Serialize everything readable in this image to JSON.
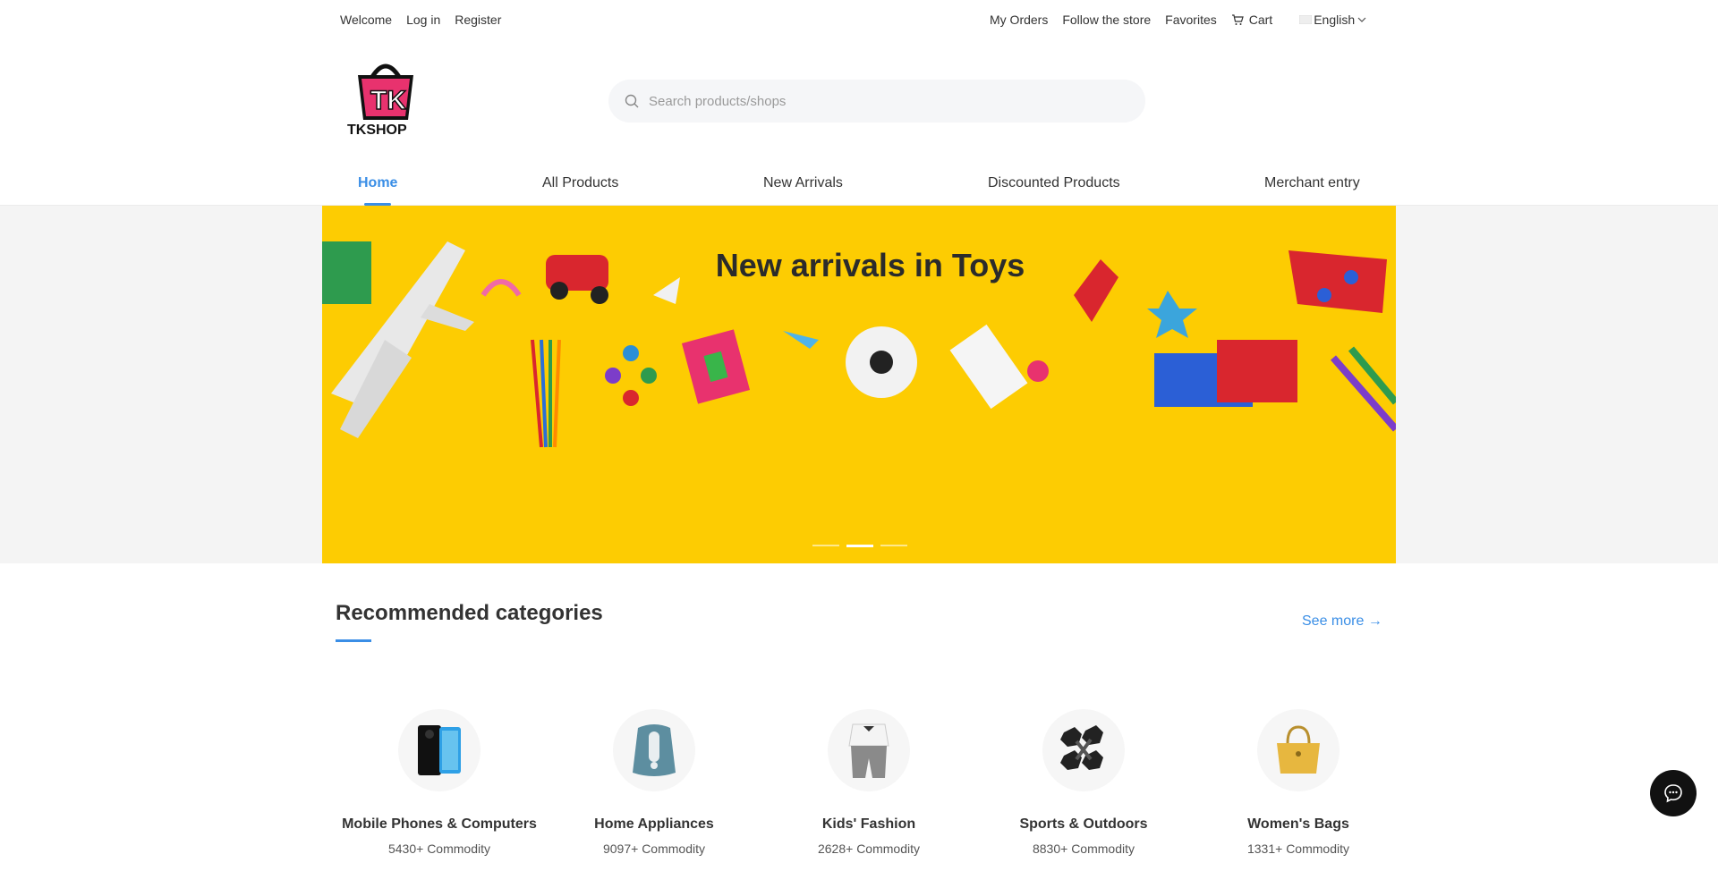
{
  "topbar": {
    "welcome": "Welcome",
    "login": "Log in",
    "register": "Register",
    "my_orders": "My Orders",
    "follow_store": "Follow the store",
    "favorites": "Favorites",
    "cart": "Cart",
    "language": "English"
  },
  "header": {
    "logo_text": "TKSHOP",
    "search_placeholder": "Search products/shops"
  },
  "nav": {
    "items": [
      {
        "label": "Home",
        "active": true
      },
      {
        "label": "All Products"
      },
      {
        "label": "New Arrivals"
      },
      {
        "label": "Discounted Products"
      },
      {
        "label": "Merchant entry"
      }
    ]
  },
  "banner": {
    "title": "New arrivals in Toys",
    "background_color": "#fdcc02",
    "slide_count": 3,
    "active_slide": 2
  },
  "recommended": {
    "title": "Recommended categories",
    "see_more": "See more →",
    "categories": [
      {
        "name": "Mobile Phones & Computers",
        "count": "5430+ Commodity",
        "icon": "phone-icon"
      },
      {
        "name": "Home Appliances",
        "count": "9097+ Commodity",
        "icon": "air-fryer-icon"
      },
      {
        "name": "Kids' Fashion",
        "count": "2628+ Commodity",
        "icon": "kids-outfit-icon"
      },
      {
        "name": "Sports & Outdoors",
        "count": "8830+ Commodity",
        "icon": "dumbbell-icon"
      },
      {
        "name": "Women's Bags",
        "count": "1331+ Commodity",
        "icon": "handbag-icon"
      }
    ]
  },
  "colors": {
    "accent": "#3a8ee6",
    "brand_pink": "#e8326e"
  }
}
